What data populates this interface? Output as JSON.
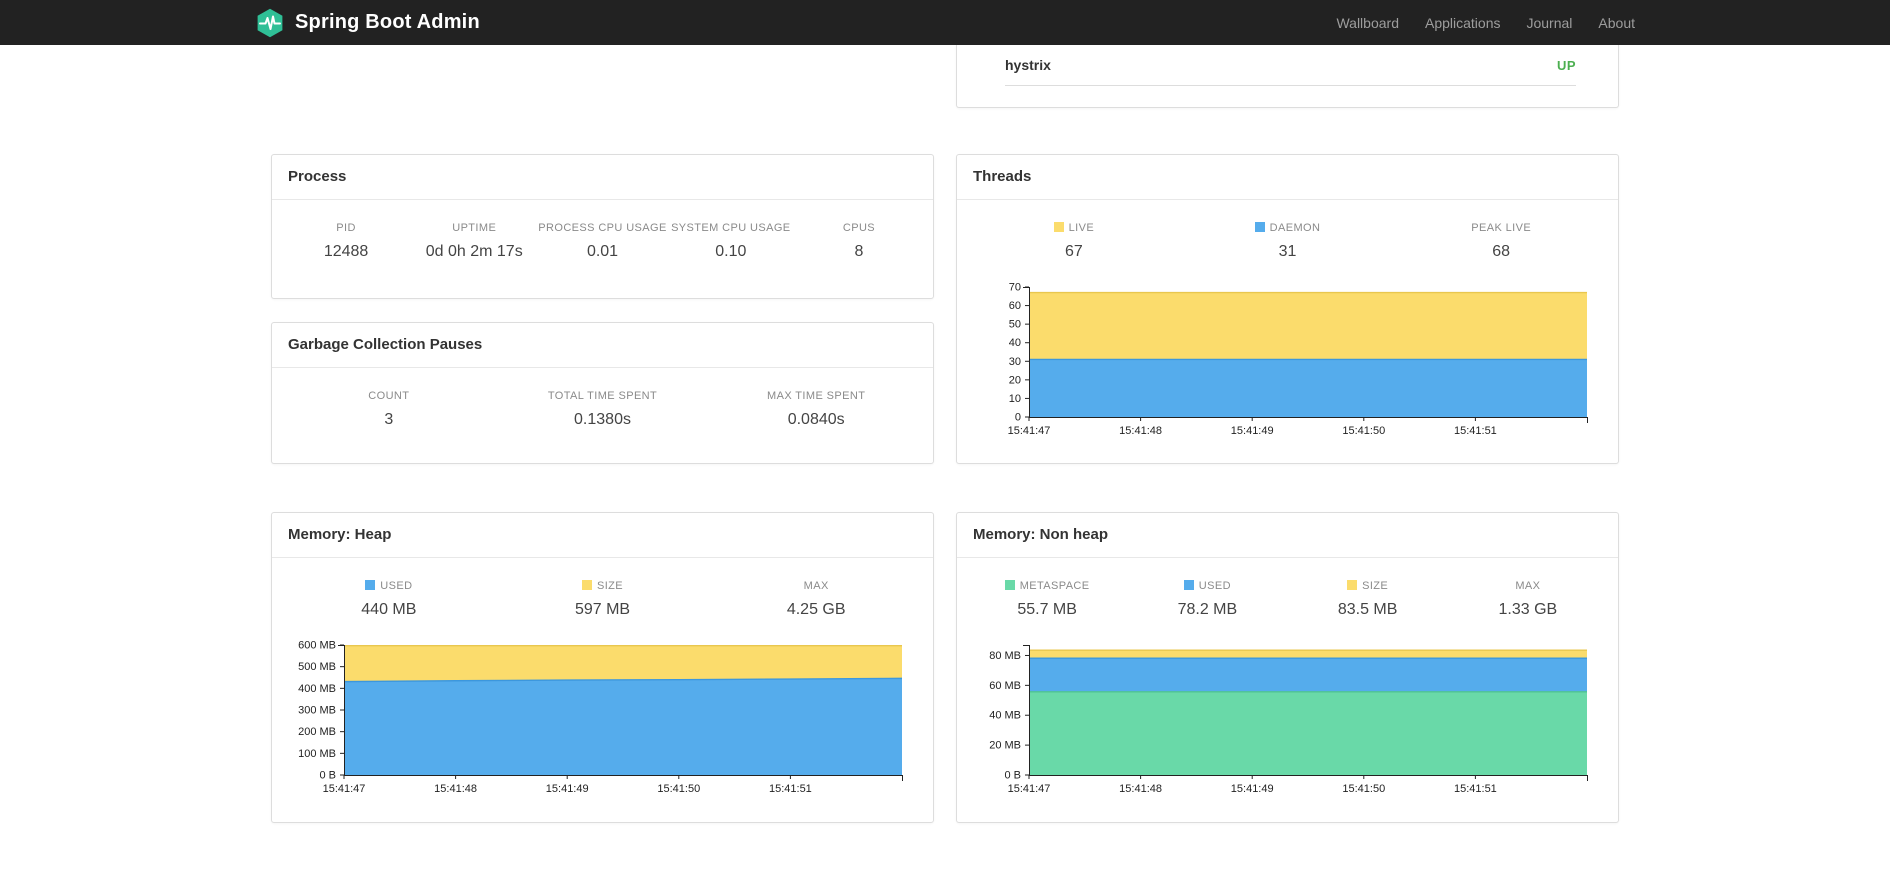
{
  "navbar": {
    "brand": "Spring Boot Admin",
    "links": [
      {
        "label": "Wallboard"
      },
      {
        "label": "Applications"
      },
      {
        "label": "Journal"
      },
      {
        "label": "About"
      }
    ]
  },
  "application": {
    "name": "hystrix",
    "status": "UP",
    "status_color": "#4CAF50"
  },
  "process": {
    "title": "Process",
    "metrics": [
      {
        "label": "PID",
        "value": "12488"
      },
      {
        "label": "UPTIME",
        "value": "0d 0h 2m 17s"
      },
      {
        "label": "PROCESS CPU USAGE",
        "value": "0.01"
      },
      {
        "label": "SYSTEM CPU USAGE",
        "value": "0.10"
      },
      {
        "label": "CPUS",
        "value": "8"
      }
    ]
  },
  "gc": {
    "title": "Garbage Collection Pauses",
    "metrics": [
      {
        "label": "COUNT",
        "value": "3"
      },
      {
        "label": "TOTAL TIME SPENT",
        "value": "0.1380s"
      },
      {
        "label": "MAX TIME SPENT",
        "value": "0.0840s"
      }
    ]
  },
  "threads": {
    "title": "Threads",
    "legend": [
      {
        "label": "LIVE",
        "value": "67",
        "color": "#FBDC6C"
      },
      {
        "label": "DAEMON",
        "value": "31",
        "color": "#55ACEC"
      },
      {
        "label": "PEAK LIVE",
        "value": "68"
      }
    ]
  },
  "heap": {
    "title": "Memory: Heap",
    "legend": [
      {
        "label": "USED",
        "value": "440 MB",
        "color": "#55ACEC"
      },
      {
        "label": "SIZE",
        "value": "597 MB",
        "color": "#FBDC6C"
      },
      {
        "label": "MAX",
        "value": "4.25 GB"
      }
    ]
  },
  "nonheap": {
    "title": "Memory: Non heap",
    "legend": [
      {
        "label": "METASPACE",
        "value": "55.7 MB",
        "color": "#69D9A8"
      },
      {
        "label": "USED",
        "value": "78.2 MB",
        "color": "#55ACEC"
      },
      {
        "label": "SIZE",
        "value": "83.5 MB",
        "color": "#FBDC6C"
      },
      {
        "label": "MAX",
        "value": "1.33 GB"
      }
    ]
  },
  "chart_data": [
    {
      "id": "threads",
      "type": "area",
      "title": "Threads",
      "x_labels": [
        "15:41:47",
        "15:41:48",
        "15:41:49",
        "15:41:50",
        "15:41:51"
      ],
      "y_max": 70,
      "y_ticks": [
        {
          "v": 0,
          "label": "0"
        },
        {
          "v": 10,
          "label": "10"
        },
        {
          "v": 20,
          "label": "20"
        },
        {
          "v": 30,
          "label": "30"
        },
        {
          "v": 40,
          "label": "40"
        },
        {
          "v": 50,
          "label": "50"
        },
        {
          "v": 60,
          "label": "60"
        },
        {
          "v": 70,
          "label": "70"
        }
      ],
      "series": [
        {
          "name": "LIVE",
          "fill": "#FBDC6C",
          "stroke": "#E9C74F",
          "values": [
            67,
            67,
            67,
            67,
            67,
            67
          ]
        },
        {
          "name": "DAEMON",
          "fill": "#55ACEC",
          "stroke": "#3C97DD",
          "values": [
            31,
            31,
            31,
            31,
            31,
            31
          ]
        }
      ]
    },
    {
      "id": "heap",
      "type": "area",
      "title": "Memory: Heap",
      "x_labels": [
        "15:41:47",
        "15:41:48",
        "15:41:49",
        "15:41:50",
        "15:41:51"
      ],
      "y_max": 600,
      "y_ticks": [
        {
          "v": 0,
          "label": "0 B"
        },
        {
          "v": 100,
          "label": "100 MB"
        },
        {
          "v": 200,
          "label": "200 MB"
        },
        {
          "v": 300,
          "label": "300 MB"
        },
        {
          "v": 400,
          "label": "400 MB"
        },
        {
          "v": 500,
          "label": "500 MB"
        },
        {
          "v": 600,
          "label": "600 MB"
        }
      ],
      "series": [
        {
          "name": "SIZE",
          "fill": "#FBDC6C",
          "stroke": "#E9C74F",
          "values": [
            597,
            597,
            597,
            597,
            597,
            597
          ]
        },
        {
          "name": "USED",
          "fill": "#55ACEC",
          "stroke": "#3C97DD",
          "values": [
            431,
            435,
            438,
            440,
            443,
            446
          ]
        }
      ]
    },
    {
      "id": "nonheap",
      "type": "area",
      "title": "Memory: Non heap",
      "x_labels": [
        "15:41:47",
        "15:41:48",
        "15:41:49",
        "15:41:50",
        "15:41:51"
      ],
      "y_max": 87,
      "y_ticks": [
        {
          "v": 0,
          "label": "0 B"
        },
        {
          "v": 20,
          "label": "20 MB"
        },
        {
          "v": 40,
          "label": "40 MB"
        },
        {
          "v": 60,
          "label": "60 MB"
        },
        {
          "v": 80,
          "label": "80 MB"
        }
      ],
      "series": [
        {
          "name": "SIZE",
          "fill": "#FBDC6C",
          "stroke": "#E9C74F",
          "values": [
            83.5,
            83.5,
            83.5,
            83.5,
            83.5,
            83.5
          ]
        },
        {
          "name": "USED",
          "fill": "#55ACEC",
          "stroke": "#3C97DD",
          "values": [
            78.2,
            78.2,
            78.2,
            78.2,
            78.2,
            78.2
          ]
        },
        {
          "name": "METASPACE",
          "fill": "#69D9A8",
          "stroke": "#4FC492",
          "values": [
            55.7,
            55.7,
            55.7,
            55.7,
            55.7,
            55.7
          ]
        }
      ]
    }
  ]
}
